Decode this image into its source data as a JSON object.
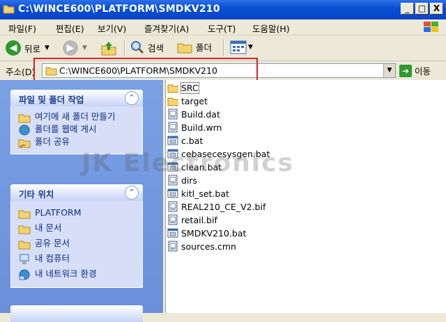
{
  "window": {
    "title": "C:\\WINCE600\\PLATFORM\\SMDKV210",
    "minimize": "_",
    "maximize": "□",
    "close": "X"
  },
  "menu": [
    "파일(F)",
    "편집(E)",
    "보기(V)",
    "즐겨찾기(A)",
    "도구(T)",
    "도움말(H)"
  ],
  "toolbar": {
    "back": "뒤로",
    "search": "검색",
    "folders": "폴더"
  },
  "address": {
    "label": "주소(D)",
    "value": "C:\\WINCE600\\PLATFORM\\SMDKV210",
    "go": "이동"
  },
  "tasks_panel": {
    "title": "파일 및 폴더 작업",
    "items": [
      {
        "label": "여기에 새 폴더 만들기",
        "icon": "new-folder-icon"
      },
      {
        "label": "폴더를 웹에 게시",
        "icon": "web-publish-icon"
      },
      {
        "label": "폴더 공유",
        "icon": "share-folder-icon"
      }
    ]
  },
  "places_panel": {
    "title": "기타 위치",
    "items": [
      {
        "label": "PLATFORM",
        "icon": "folder-icon"
      },
      {
        "label": "내 문서",
        "icon": "folder-icon"
      },
      {
        "label": "공유 문서",
        "icon": "folder-icon"
      },
      {
        "label": "내 컴퓨터",
        "icon": "computer-icon"
      },
      {
        "label": "내 네트워크 환경",
        "icon": "network-icon"
      }
    ]
  },
  "files": [
    {
      "name": "SRC",
      "type": "folder"
    },
    {
      "name": "target",
      "type": "folder"
    },
    {
      "name": "Build.dat",
      "type": "file"
    },
    {
      "name": "Build.wrn",
      "type": "file"
    },
    {
      "name": "c.bat",
      "type": "bat"
    },
    {
      "name": "cebasecesysgen.bat",
      "type": "bat"
    },
    {
      "name": "clean.bat",
      "type": "bat"
    },
    {
      "name": "dirs",
      "type": "file"
    },
    {
      "name": "kitl_set.bat",
      "type": "bat"
    },
    {
      "name": "REAL210_CE_V2.bif",
      "type": "file"
    },
    {
      "name": "retail.bif",
      "type": "file"
    },
    {
      "name": "SMDKV210.bat",
      "type": "bat"
    },
    {
      "name": "sources.cmn",
      "type": "file"
    }
  ],
  "watermark": "JK Electronics",
  "colors": {
    "titlebar": "#0a4fd4",
    "highlight": "#d9202a",
    "taskpane": "#6b8fd9"
  }
}
